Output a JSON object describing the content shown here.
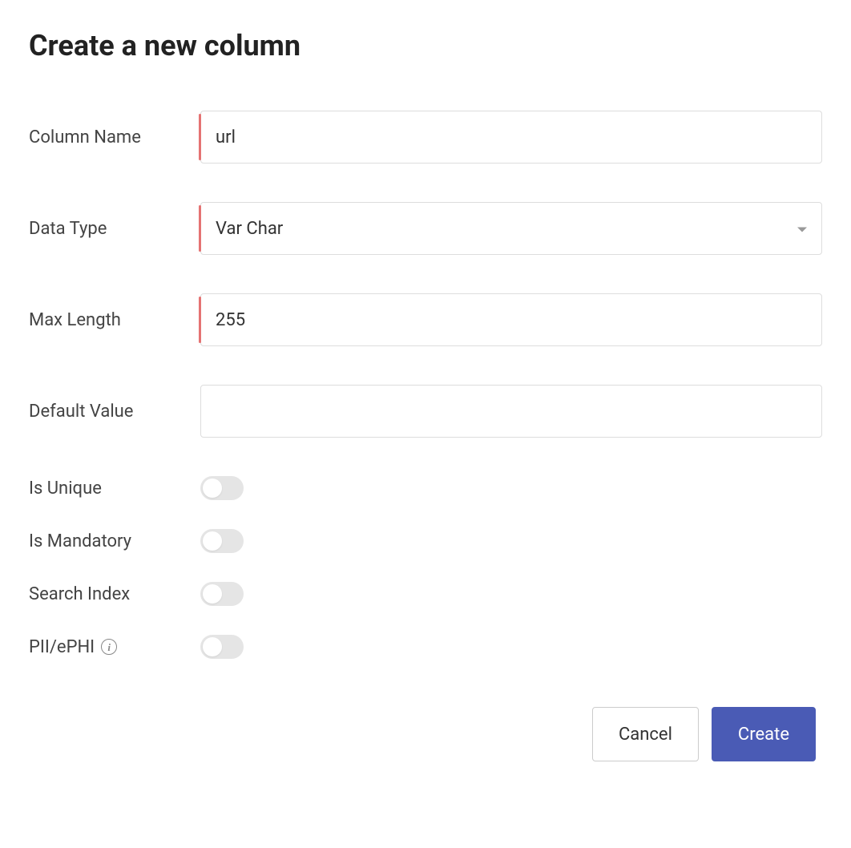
{
  "title": "Create a new column",
  "fields": {
    "columnName": {
      "label": "Column Name",
      "value": "url",
      "required": true
    },
    "dataType": {
      "label": "Data Type",
      "value": "Var Char",
      "required": true
    },
    "maxLength": {
      "label": "Max Length",
      "value": "255",
      "required": true
    },
    "defaultValue": {
      "label": "Default Value",
      "value": "",
      "required": false
    },
    "isUnique": {
      "label": "Is Unique",
      "value": false
    },
    "isMandatory": {
      "label": "Is Mandatory",
      "value": false
    },
    "searchIndex": {
      "label": "Search Index",
      "value": false
    },
    "piiEphi": {
      "label": "PII/ePHI",
      "value": false
    }
  },
  "footer": {
    "cancel": "Cancel",
    "create": "Create"
  }
}
